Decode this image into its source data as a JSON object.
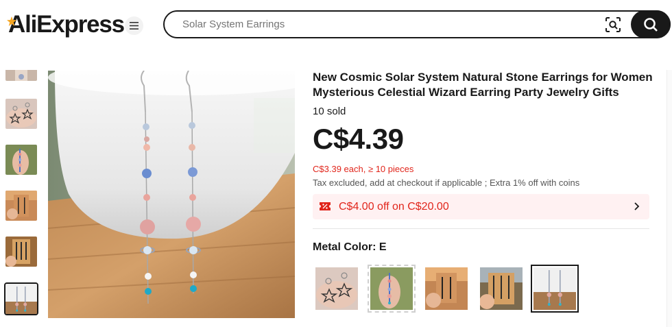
{
  "header": {
    "logo_text": "AliExpress",
    "search_placeholder": "Solar System Earrings",
    "icons": [
      "menu-icon",
      "camera-search-icon",
      "search-icon"
    ]
  },
  "gallery": {
    "thumbnails": [
      "earring-stars",
      "earring-hand-blue",
      "earring-card-sunset",
      "earring-hand-dark",
      "earring-bowl-selected"
    ],
    "active_index": 4
  },
  "product": {
    "title": "New Cosmic Solar System Natural Stone Earrings for Women Mysterious Celestial Wizard Earring Party Jewelry Gifts",
    "sold": "10 sold",
    "price": "C$4.39",
    "bulk_price": "C$3.39 each, ≥ 10 pieces",
    "tax_note": "Tax excluded, add at checkout if applicable ; Extra 1% off with coins",
    "coupon": "C$4.00 off on C$20.00",
    "color_label": "Metal Color: E",
    "swatches": [
      "A",
      "B",
      "C",
      "D",
      "E"
    ],
    "selected_swatch": "E"
  },
  "colors": {
    "accent": "#e1251b",
    "coupon_bg": "#fff1f2",
    "text": "#191919"
  }
}
